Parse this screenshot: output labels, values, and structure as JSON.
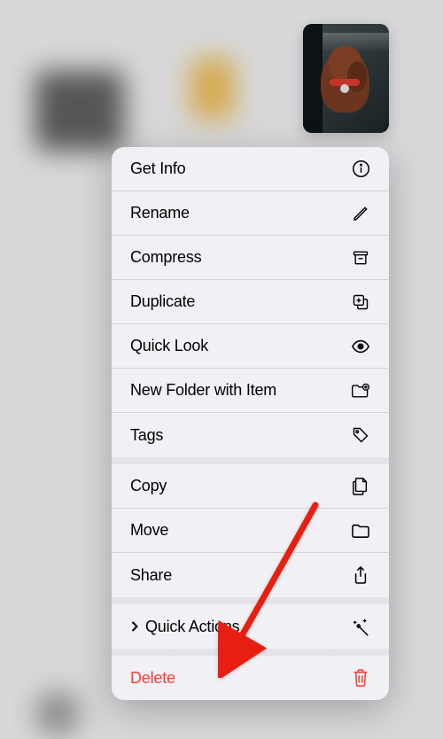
{
  "menu": {
    "sections": [
      {
        "items": [
          {
            "id": "get-info",
            "label": "Get Info",
            "icon": "info-icon"
          },
          {
            "id": "rename",
            "label": "Rename",
            "icon": "pencil-icon"
          },
          {
            "id": "compress",
            "label": "Compress",
            "icon": "archive-icon"
          },
          {
            "id": "duplicate",
            "label": "Duplicate",
            "icon": "duplicate-icon"
          },
          {
            "id": "quick-look",
            "label": "Quick Look",
            "icon": "eye-icon"
          },
          {
            "id": "new-folder",
            "label": "New Folder with Item",
            "icon": "folder-plus-icon"
          },
          {
            "id": "tags",
            "label": "Tags",
            "icon": "tag-icon"
          }
        ]
      },
      {
        "items": [
          {
            "id": "copy",
            "label": "Copy",
            "icon": "copy-doc-icon"
          },
          {
            "id": "move",
            "label": "Move",
            "icon": "folder-icon"
          },
          {
            "id": "share",
            "label": "Share",
            "icon": "share-icon"
          }
        ]
      },
      {
        "items": [
          {
            "id": "quick-actions",
            "label": "Quick Actions",
            "icon": "sparkle-wand-icon",
            "hasChevron": true
          }
        ]
      },
      {
        "items": [
          {
            "id": "delete",
            "label": "Delete",
            "icon": "trash-icon",
            "destructive": true
          }
        ]
      }
    ]
  },
  "annotation": {
    "arrow_color": "#e81e10",
    "points_to": "quick-actions"
  }
}
